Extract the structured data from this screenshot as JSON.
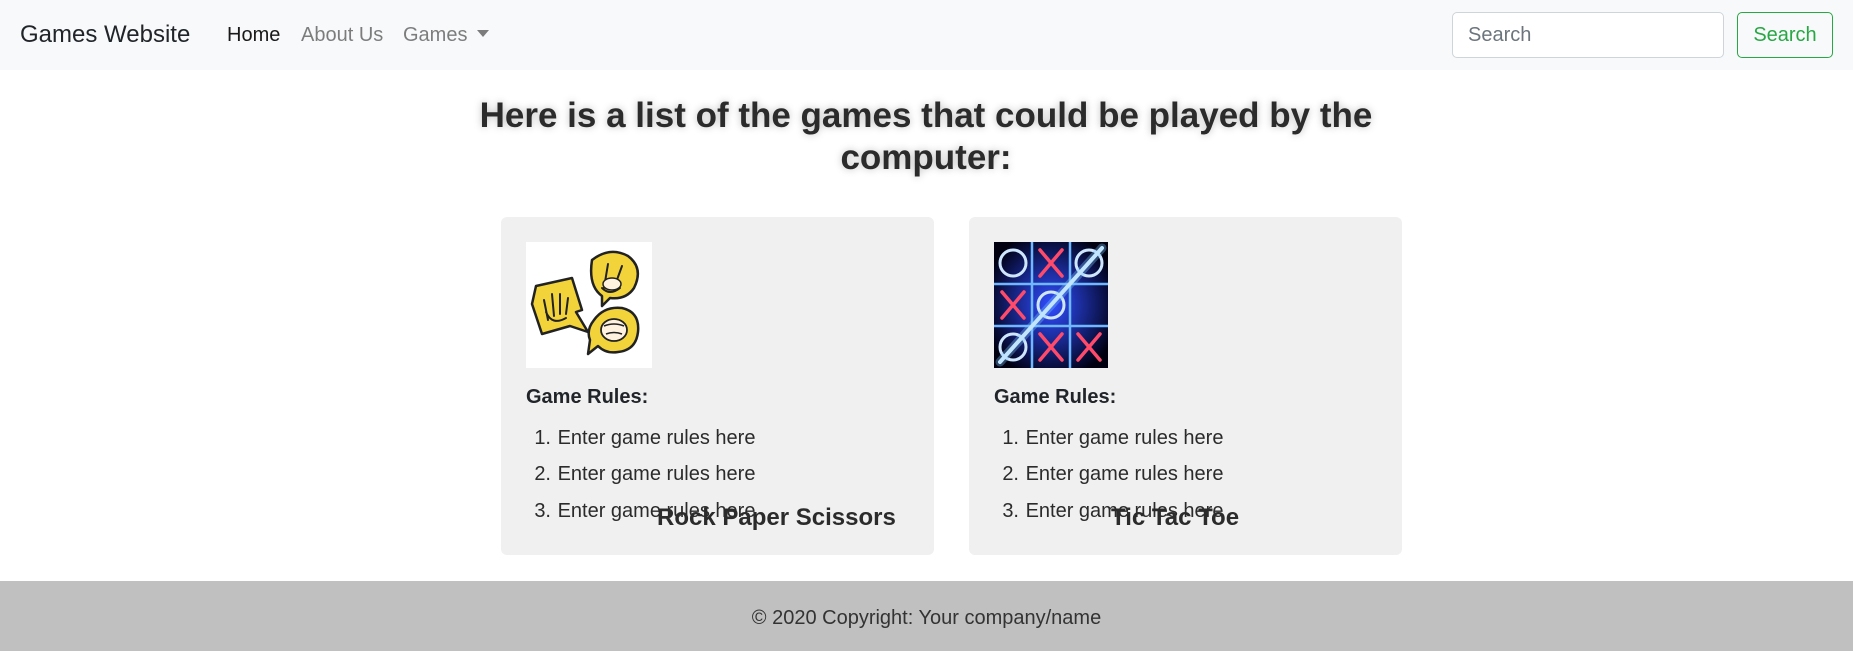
{
  "navbar": {
    "brand": "Games Website",
    "links": [
      {
        "label": "Home",
        "active": true
      },
      {
        "label": "About Us",
        "active": false
      },
      {
        "label": "Games",
        "active": false,
        "icon": "caret-down-icon"
      }
    ],
    "search": {
      "placeholder": "Search",
      "value": "",
      "button_label": "Search"
    }
  },
  "main": {
    "heading_line1": "Here is a list of the games that could be played by the",
    "heading_line2": "computer:",
    "cards": [
      {
        "title": "Rock Paper Scissors",
        "image": "rock-paper-scissors-hands-image",
        "rules_heading": "Game Rules:",
        "rules": [
          {
            "num": "1.",
            "text": "Enter game rules here"
          },
          {
            "num": "2.",
            "text": "Enter game rules here"
          },
          {
            "num": "3.",
            "text": "Enter game rules here"
          }
        ]
      },
      {
        "title": "Tic Tac Toe",
        "image": "tic-tac-toe-neon-board-image",
        "rules_heading": "Game Rules:",
        "rules": [
          {
            "num": "1.",
            "text": "Enter game rules here"
          },
          {
            "num": "2.",
            "text": "Enter game rules here"
          },
          {
            "num": "3.",
            "text": "Enter game rules here"
          }
        ]
      }
    ]
  },
  "footer": {
    "text": "© 2020 Copyright: Your company/name"
  },
  "colors": {
    "navbar_bg": "#f8f9fa",
    "card_bg": "#f0f0f0",
    "footer_bg": "#c0c0c0",
    "search_button": "#28a745",
    "rps_yellow": "#f2d43a",
    "ttt_board": "#000000",
    "ttt_blue": "#4fa8ff",
    "ttt_red": "#ff3a5a"
  }
}
